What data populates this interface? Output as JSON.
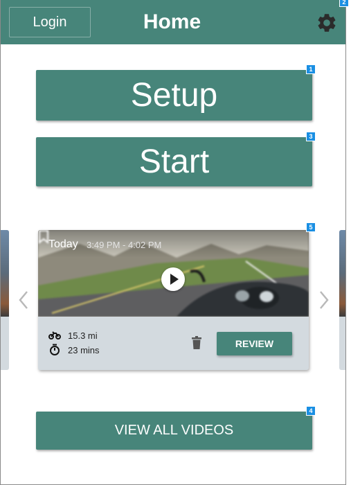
{
  "header": {
    "login_label": "Login",
    "title": "Home",
    "settings_icon": "gear-icon"
  },
  "buttons": {
    "setup_label": "Setup",
    "start_label": "Start",
    "view_all_label": "VIEW ALL VIDEOS"
  },
  "annotations": {
    "setup": "1",
    "settings": "2",
    "start": "3",
    "view_all": "4",
    "carousel": "5"
  },
  "video_card": {
    "day": "Today",
    "time_range": "3:49 PM - 4:02 PM",
    "distance": "15.3 mi",
    "duration": "23 mins",
    "review_label": "REVIEW",
    "icons": [
      "bookmark-icon",
      "play-icon",
      "motorcycle-icon",
      "stopwatch-icon",
      "trash-icon",
      "chevron-left-icon",
      "chevron-right-icon"
    ]
  },
  "colors": {
    "primary": "#47857a",
    "card_background": "#d3dadf",
    "annotation_badge": "#1a8fe3"
  }
}
